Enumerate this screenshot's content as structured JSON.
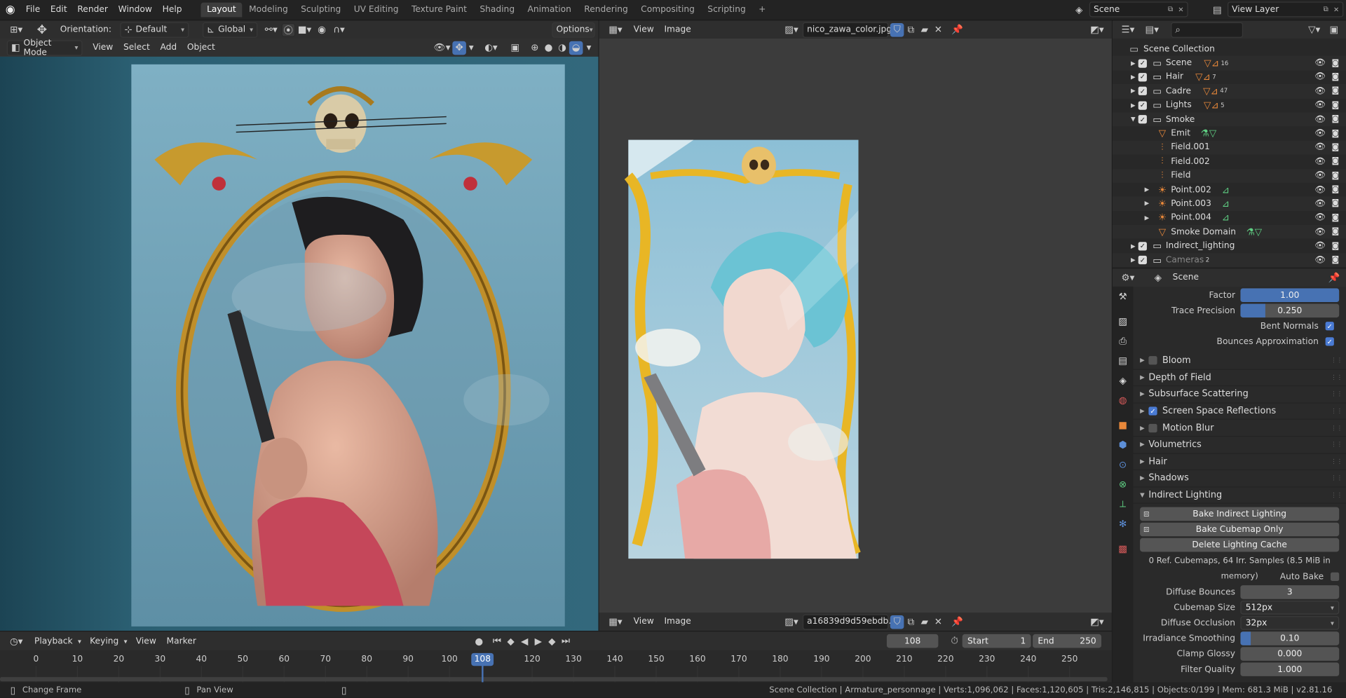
{
  "topbar": {
    "menus": [
      "File",
      "Edit",
      "Render",
      "Window",
      "Help"
    ],
    "workspaces": [
      "Layout",
      "Modeling",
      "Sculpting",
      "UV Editing",
      "Texture Paint",
      "Shading",
      "Animation",
      "Rendering",
      "Compositing",
      "Scripting"
    ],
    "active_workspace": "Layout",
    "add_tab": "+",
    "scene_name": "Scene",
    "view_layer": "View Layer"
  },
  "viewport": {
    "orientation_label": "Orientation:",
    "orientation_value": "Default",
    "transform_space": "Global",
    "options": "Options",
    "mode": "Object Mode",
    "menus": [
      "View",
      "Select",
      "Add",
      "Object"
    ]
  },
  "image_editor": {
    "menus": [
      "View",
      "Image"
    ],
    "image_name": "nico_zawa_color.jpg",
    "bottom_menus": [
      "View",
      "Image"
    ],
    "bottom_image_name": "a16839d9d59ebdb..."
  },
  "outliner": {
    "search_placeholder": "",
    "root": "Scene Collection",
    "rows": [
      {
        "name": "Scene",
        "depth": 0,
        "checked": true,
        "expanded": false,
        "type": "collection",
        "badge": "16"
      },
      {
        "name": "Hair",
        "depth": 0,
        "checked": true,
        "expanded": false,
        "type": "collection",
        "badge": "7"
      },
      {
        "name": "Cadre",
        "depth": 0,
        "checked": true,
        "expanded": false,
        "type": "collection",
        "badge": "47"
      },
      {
        "name": "Lights",
        "depth": 0,
        "checked": true,
        "expanded": false,
        "type": "collection",
        "badge": "5"
      },
      {
        "name": "Smoke",
        "depth": 0,
        "checked": true,
        "expanded": true,
        "type": "collection",
        "badge": ""
      },
      {
        "name": "Emit",
        "depth": 1,
        "checked": null,
        "expanded": null,
        "type": "mesh",
        "badge": ""
      },
      {
        "name": "Field.001",
        "depth": 1,
        "checked": null,
        "expanded": null,
        "type": "field",
        "badge": ""
      },
      {
        "name": "Field.002",
        "depth": 1,
        "checked": null,
        "expanded": null,
        "type": "field",
        "badge": ""
      },
      {
        "name": "Field",
        "depth": 1,
        "checked": null,
        "expanded": null,
        "type": "field",
        "badge": ""
      },
      {
        "name": "Point.002",
        "depth": 1,
        "checked": null,
        "expanded": false,
        "type": "light",
        "badge": ""
      },
      {
        "name": "Point.003",
        "depth": 1,
        "checked": null,
        "expanded": false,
        "type": "light",
        "badge": ""
      },
      {
        "name": "Point.004",
        "depth": 1,
        "checked": null,
        "expanded": false,
        "type": "light",
        "badge": ""
      },
      {
        "name": "Smoke Domain",
        "depth": 1,
        "checked": null,
        "expanded": null,
        "type": "mesh",
        "badge": ""
      },
      {
        "name": "Indirect_lighting",
        "depth": 0,
        "checked": true,
        "expanded": false,
        "type": "collection",
        "badge": ""
      },
      {
        "name": "Cameras",
        "depth": 0,
        "checked": true,
        "expanded": false,
        "type": "collection",
        "badge": "2"
      }
    ]
  },
  "properties": {
    "context": "Scene",
    "ao": [
      {
        "label": "Factor",
        "value": "1.00",
        "fraction": 1.0
      },
      {
        "label": "Trace Precision",
        "value": "0.250",
        "fraction": 0.25
      }
    ],
    "checks": [
      {
        "label": "Bent Normals",
        "checked": true
      },
      {
        "label": "Bounces Approximation",
        "checked": true
      }
    ],
    "panels": [
      {
        "label": "Bloom",
        "checkbox": true,
        "checked": false,
        "open": false
      },
      {
        "label": "Depth of Field",
        "checkbox": false,
        "checked": false,
        "open": false
      },
      {
        "label": "Subsurface Scattering",
        "checkbox": false,
        "checked": false,
        "open": false
      },
      {
        "label": "Screen Space Reflections",
        "checkbox": true,
        "checked": true,
        "open": false
      },
      {
        "label": "Motion Blur",
        "checkbox": true,
        "checked": false,
        "open": false
      },
      {
        "label": "Volumetrics",
        "checkbox": false,
        "checked": false,
        "open": false
      },
      {
        "label": "Hair",
        "checkbox": false,
        "checked": false,
        "open": false
      },
      {
        "label": "Shadows",
        "checkbox": false,
        "checked": false,
        "open": false
      },
      {
        "label": "Indirect Lighting",
        "checkbox": false,
        "checked": false,
        "open": true
      }
    ],
    "bake_indirect": "Bake Indirect Lighting",
    "bake_cubemap": "Bake Cubemap Only",
    "delete_cache": "Delete Lighting Cache",
    "cache_info": "0 Ref. Cubemaps, 64 Irr. Samples (8.5 MiB in memory)",
    "auto_bake": "Auto Bake",
    "diffuse_bounces_label": "Diffuse Bounces",
    "diffuse_bounces": "3",
    "cubemap_size_label": "Cubemap Size",
    "cubemap_size": "512px",
    "diffuse_occlusion_label": "Diffuse Occlusion",
    "diffuse_occlusion": "32px",
    "irradiance_smoothing_label": "Irradiance Smoothing",
    "irradiance_smoothing": "0.10",
    "irradiance_smoothing_fraction": 0.1,
    "clamp_glossy_label": "Clamp Glossy",
    "clamp_glossy": "0.000",
    "filter_quality_label": "Filter Quality",
    "filter_quality": "1.000"
  },
  "timeline": {
    "menus": [
      "Playback",
      "Keying",
      "View",
      "Marker"
    ],
    "current_frame": "108",
    "start_label": "Start",
    "start": "1",
    "end_label": "End",
    "end": "250",
    "ticks": [
      "0",
      "10",
      "20",
      "30",
      "40",
      "50",
      "60",
      "70",
      "80",
      "90",
      "100",
      "120",
      "130",
      "140",
      "150",
      "160",
      "170",
      "180",
      "190",
      "200",
      "210",
      "220",
      "230",
      "240",
      "250"
    ],
    "playhead": "108"
  },
  "status": {
    "left": "Change Frame",
    "middle": "Pan View",
    "right": "Scene Collection | Armature_personnage | Verts:1,096,062 | Faces:1,120,605 | Tris:2,146,815 | Objects:0/199 | Mem: 681.3 MiB | v2.81.16"
  },
  "colors": {
    "accent": "#4772b3",
    "bg": "#1d1d1d",
    "panel": "#2a2a2a",
    "orange_icon": "#e8883a",
    "green_icon": "#5fcf83"
  }
}
